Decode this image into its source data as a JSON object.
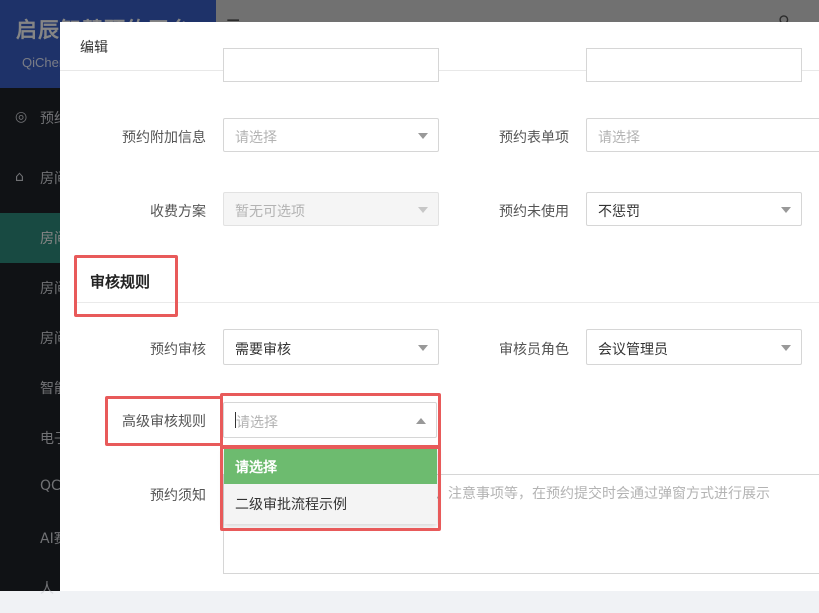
{
  "app": {
    "brand_title": "启辰智慧预约平台",
    "brand_sub": "QiChen",
    "menu": [
      {
        "label": "预约",
        "icon": "eye-icon"
      },
      {
        "label": "房间",
        "icon": "home-icon"
      },
      {
        "label": "房间",
        "icon": ""
      },
      {
        "label": "房间",
        "icon": ""
      },
      {
        "label": "房间",
        "icon": ""
      },
      {
        "label": "智能",
        "icon": ""
      },
      {
        "label": "电子",
        "icon": ""
      },
      {
        "label": "QC",
        "icon": ""
      },
      {
        "label": "AI赛",
        "icon": ""
      },
      {
        "label": "人",
        "icon": ""
      }
    ]
  },
  "modal": {
    "title": "编辑",
    "fields": {
      "extra_info": {
        "label": "预约附加信息",
        "placeholder": "请选择"
      },
      "form_items": {
        "label": "预约表单项",
        "placeholder": "请选择"
      },
      "fee_plan": {
        "label": "收费方案",
        "placeholder": "暂无可选项"
      },
      "no_show": {
        "label": "预约未使用",
        "value": "不惩罚"
      },
      "review": {
        "label": "预约审核",
        "value": "需要审核"
      },
      "reviewer_role": {
        "label": "审核员角色",
        "value": "会议管理员"
      },
      "advanced_rule": {
        "label": "高级审核规则",
        "placeholder": "请选择"
      },
      "notice": {
        "label": "预约须知",
        "placeholder": "、注意事项等，在预约提交时会通过弹窗方式进行展示"
      }
    },
    "section_title": "审核规则",
    "dropdown_options": [
      "请选择",
      "二级审批流程示例"
    ]
  }
}
